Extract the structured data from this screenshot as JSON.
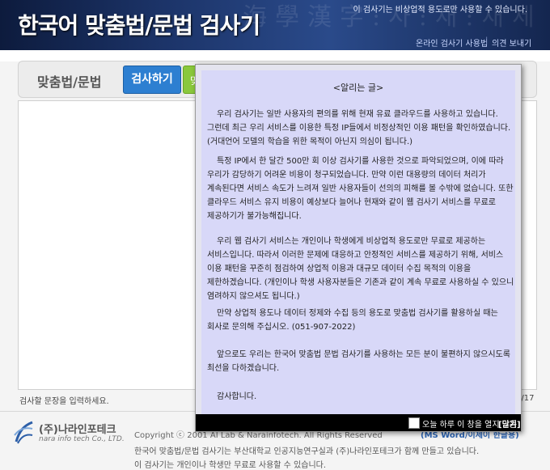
{
  "header": {
    "title": "한국어 맞춤법/문법 검사기",
    "notice": "이 검사기는 비상업적 용도로만 사용할 수 있습니다.",
    "background_text": "海學漢字:사:새:새세 寫",
    "links": [
      "온라인 검사기 사용법",
      "의견 보내기"
    ]
  },
  "toolbar": {
    "label": "맞춤법/문법",
    "check_button": "검사하기",
    "green_button": "맞"
  },
  "input": {
    "hint": "검사할 문장을 입력하세요.",
    "counter": "4/17"
  },
  "popup": {
    "title": "<알리는 글>",
    "paragraphs": [
      "우리 검사기는 일반 사용자의 편의를 위해 현재 유료 클라우드를 사용하고 있습니다. 그런데 최근 우리 서비스를 이용한 특정 IP들에서 비정상적인 이용 패턴을 확인하였습니다. (거대언어 모델의 학습을 위한 목적이 아닌지 의심이 됩니다.)",
      "특정 IP에서 한 달간 500만 회 이상 검사기를 사용한 것으로 파악되었으며, 이에 따라 우리가 감당하기 어려운 비용이 청구되었습니다. 만약 이런 대용량의 데이터 처리가 계속된다면 서비스 속도가 느려져 일반 사용자들이 선의의 피해를 볼 수밖에 없습니다. 또한 클라우드 서비스 유지 비용이 예상보다 늘어나 현재와 같이 웹 검사기 서비스를 무료로 제공하기가 불가능해집니다.",
      "우리 웹 검사기 서비스는 개인이나 학생에게 비상업적 용도로만 무료로 제공하는 서비스입니다. 따라서 이러한 문제에 대응하고 안정적인 서비스를 제공하기 위해, 서비스 이용 패턴을 꾸준히 점검하여 상업적 이용과 대규모 데이터 수집 목적의 이용을 제한하겠습니다. (개인이나 학생 사용자분들은 기존과 같이 계속 무료로 사용하실 수 있으니 염려하지 않으셔도 됩니다.)",
      "만약 상업적 용도나 데이터 정제와 수집 등의 용도로 맞춤법 검사기를 활용하실 때는 회사로 문의해 주십시오. (051-907-2022)",
      "앞으로도 우리는 한국어 맞춤법 문법 검사기를 사용하는 모든 분이 불편하지 않으시도록 최선을 다하겠습니다.",
      "감사합니다."
    ],
    "dont_show_label": "오늘 하루 이 창을 열지 않음",
    "close_label": "[닫기]"
  },
  "footer": {
    "logo_korean": "(주)나라인포테크",
    "logo_english": "nara info tech Co., LTD.",
    "copyright": "Copyright ⓒ 2001 AI Lab & Narainfotech. All Rights Reserved",
    "ms_word": "(MS Word/이제이 한글용)",
    "line1": "한국어 맞춤법/문법 검사기는 부산대학교 인공지능연구실과 (주)나라인포테크가 함께 만들고 있습니다.",
    "line2": "이 검사기는 개인이나 학생만 무료로 사용할 수 있습니다."
  },
  "colors": {
    "header_bg": "#1c3469",
    "check_button": "#2d7fd1",
    "green_button": "#8ac83c",
    "popup_bg": "#d8d8f8"
  }
}
